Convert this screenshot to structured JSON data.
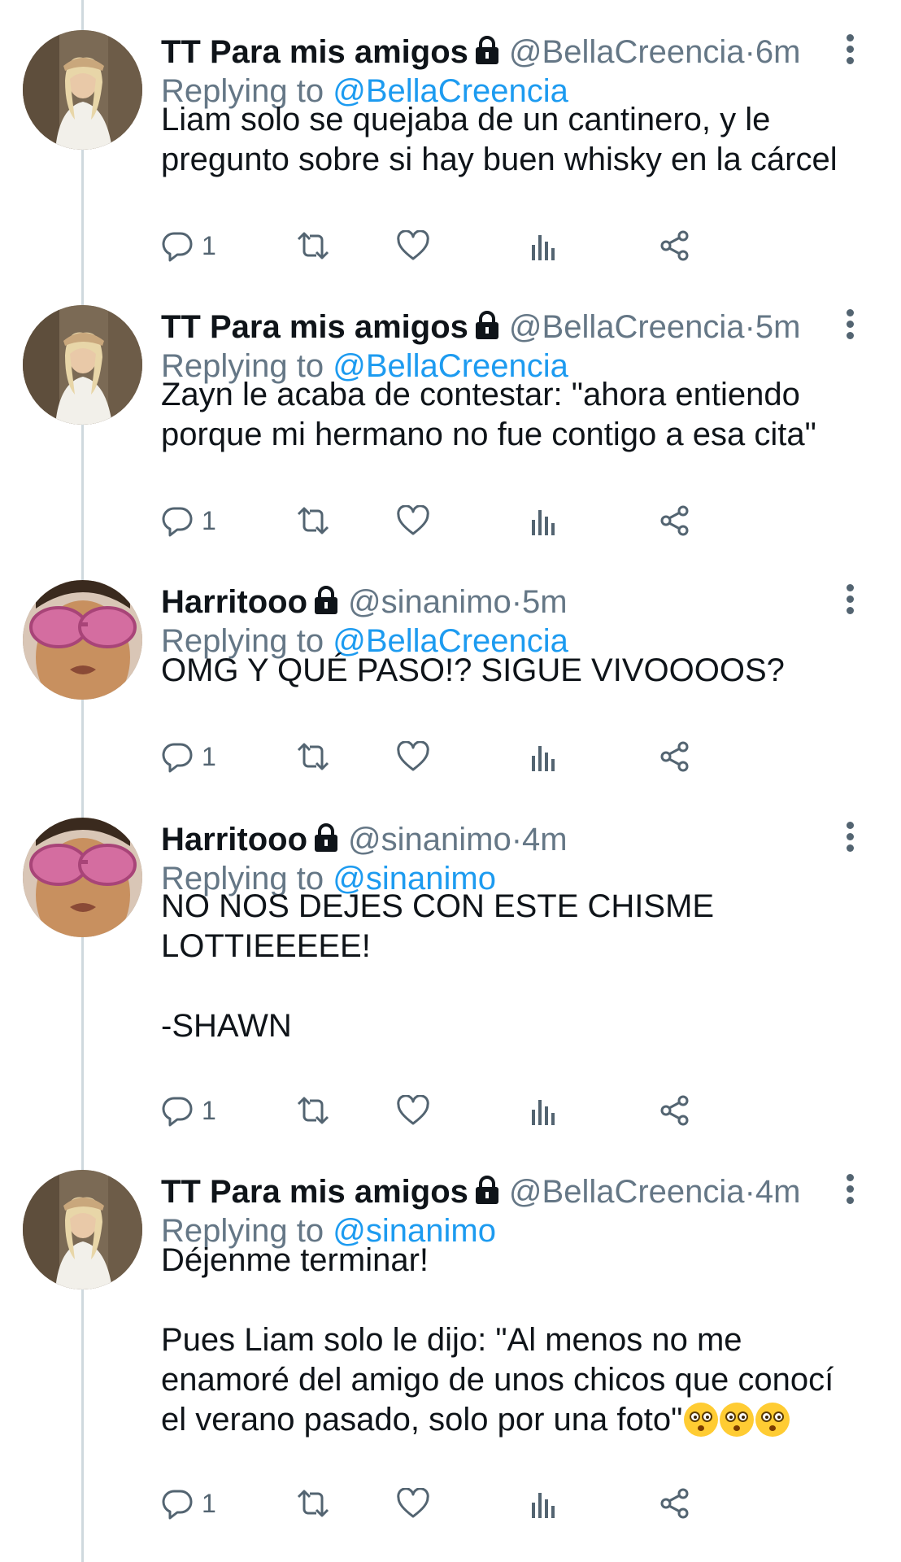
{
  "tweets": [
    {
      "name": "TT Para mis amigos",
      "handle": "@BellaCreencia",
      "sep": "·",
      "time": "6m",
      "reply_prefix": "Replying to",
      "reply_to": "@BellaCreencia",
      "text": "Liam solo se quejaba de un cantinero, y le\npregunto sobre si hay buen whisky en la cárcel",
      "replies": "1",
      "avatar": "woman-avatar"
    },
    {
      "name": "TT Para mis amigos",
      "handle": "@BellaCreencia",
      "sep": "·",
      "time": "5m",
      "reply_prefix": "Replying to",
      "reply_to": "@BellaCreencia",
      "text": "Zayn le acaba de contestar: \"ahora entiendo\nporque mi hermano no fue contigo a esa cita\"",
      "replies": "1",
      "avatar": "woman-avatar"
    },
    {
      "name": "Harritooo",
      "handle": "@sinanimo",
      "sep": "·",
      "time": "5m",
      "reply_prefix": "Replying to",
      "reply_to": "@BellaCreencia",
      "text": "OMG Y QUÉ PASO!? SIGUE VIVOOOOS?",
      "replies": "1",
      "avatar": "man-sunglasses-avatar"
    },
    {
      "name": "Harritooo",
      "handle": "@sinanimo",
      "sep": "·",
      "time": "4m",
      "reply_prefix": "Replying to",
      "reply_to": "@sinanimo",
      "text": "NO NOS DEJES CON ESTE CHISME\nLOTTIEEEEE!\n\n-SHAWN",
      "replies": "1",
      "avatar": "man-sunglasses-avatar"
    },
    {
      "name": "TT Para mis amigos",
      "handle": "@BellaCreencia",
      "sep": "·",
      "time": "4m",
      "reply_prefix": "Replying to",
      "reply_to": "@sinanimo",
      "text": "Déjenme terminar!\n\nPues Liam solo le dijo: \"Al menos no me\nenamoré del amigo de unos chicos que conocí\nel verano pasado, solo por una foto\"",
      "emoji": "😳😳😳",
      "replies": "1",
      "avatar": "woman-avatar"
    }
  ],
  "icons": {
    "lock": "lock-icon",
    "more": "more-vertical-icon",
    "reply": "reply-icon",
    "retweet": "retweet-icon",
    "like": "heart-icon",
    "analytics": "analytics-icon",
    "share": "share-icon",
    "emoji": "flushed-face-emoji"
  },
  "colors": {
    "link": "#1d9bf0",
    "secondary": "#657786",
    "text": "#0f1419",
    "thread_line": "#cfd9de"
  }
}
